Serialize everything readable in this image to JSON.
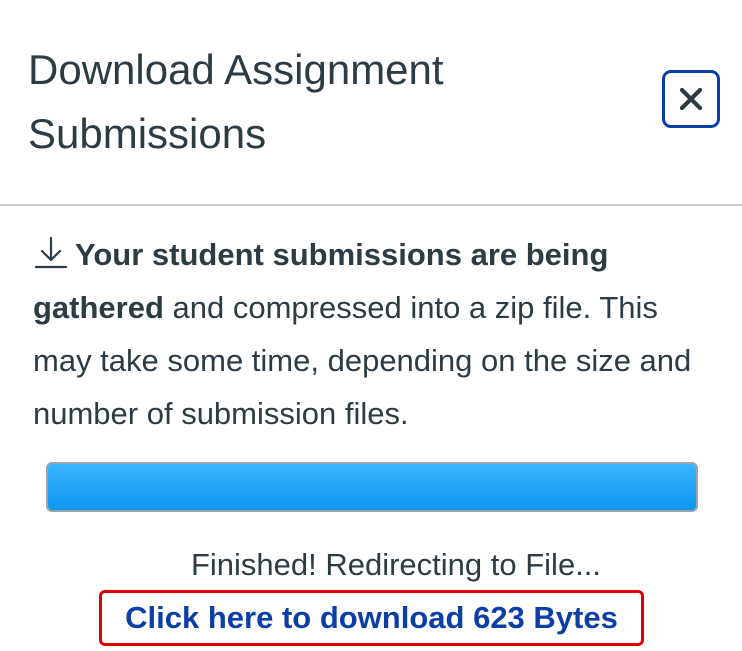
{
  "dialog": {
    "title": "Download Assignment Submissions",
    "close_icon": "close-icon"
  },
  "message": {
    "icon": "download-icon",
    "bold_text": "Your student submissions are being gathered",
    "rest_text": " and compressed into a zip file. This may take some time, depending on the size and number of submission files."
  },
  "progress": {
    "percent": 100,
    "fill_color": "#0e96f0"
  },
  "status": {
    "text": "Finished! Redirecting to File..."
  },
  "download_link": {
    "label": "Click here to download 623 Bytes",
    "highlight_color": "#e00000"
  },
  "colors": {
    "text": "#2d3b45",
    "link": "#0b3fa7",
    "divider": "#c7cdd1"
  }
}
